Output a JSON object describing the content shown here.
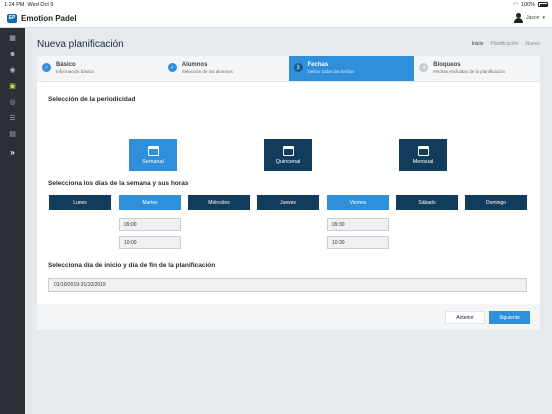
{
  "status": {
    "time": "1:24 PM",
    "date": "Wed Oct 9",
    "battery": "100%"
  },
  "app": {
    "title": "Emotion Padel",
    "logo": "EP",
    "user": "Jason"
  },
  "sidebar": {
    "items": [
      {
        "icon": "calendar-icon",
        "glyph": "▦"
      },
      {
        "icon": "users-icon",
        "glyph": "☻"
      },
      {
        "icon": "broadcast-icon",
        "glyph": "◉"
      },
      {
        "icon": "planning-icon",
        "glyph": "▣"
      },
      {
        "icon": "target-icon",
        "glyph": "◎"
      },
      {
        "icon": "list-icon",
        "glyph": "☰"
      },
      {
        "icon": "grid-icon",
        "glyph": "▤"
      }
    ],
    "expand_glyph": "»"
  },
  "page": {
    "title": "Nueva planificación",
    "breadcrumb": [
      "Inicio",
      "Planificación",
      "Nuevo"
    ]
  },
  "steps": [
    {
      "number": "✓",
      "title": "Básico",
      "sub": "Información básica",
      "state": "done"
    },
    {
      "number": "✓",
      "title": "Alumnos",
      "sub": "Selección de los alumnos",
      "state": "done"
    },
    {
      "number": "3",
      "title": "Fechas",
      "sub": "Definir todas las fechas",
      "state": "active"
    },
    {
      "number": "4",
      "title": "Bloqueos",
      "sub": "Fechas excluidas de la planificación",
      "state": "todo"
    }
  ],
  "periodicity": {
    "title": "Selección de la periodicidad",
    "options": [
      "Semanal",
      "Quincenal",
      "Mensual"
    ],
    "selected": "Semanal"
  },
  "days": {
    "title": "Selecciona los días de la semana y sus horas",
    "items": [
      "Lunes",
      "Martes",
      "Miércoles",
      "Jueves",
      "Viernes",
      "Sábado",
      "Domingo"
    ],
    "selected": [
      "Martes",
      "Viernes"
    ],
    "martes_times": [
      "09:00",
      "10:00"
    ],
    "viernes_times": [
      "09:30",
      "10:30"
    ]
  },
  "range": {
    "title": "Selecciona día de inicio y día de fin de la planificación",
    "value": "01/10/2019-31/10/2019"
  },
  "actions": {
    "prev": "Anterior",
    "next": "Siguiente"
  },
  "colors": {
    "primary": "#2f8fdb",
    "dark": "#123c5c",
    "sidebar": "#2b3036",
    "active_icon": "#c6e34a"
  }
}
